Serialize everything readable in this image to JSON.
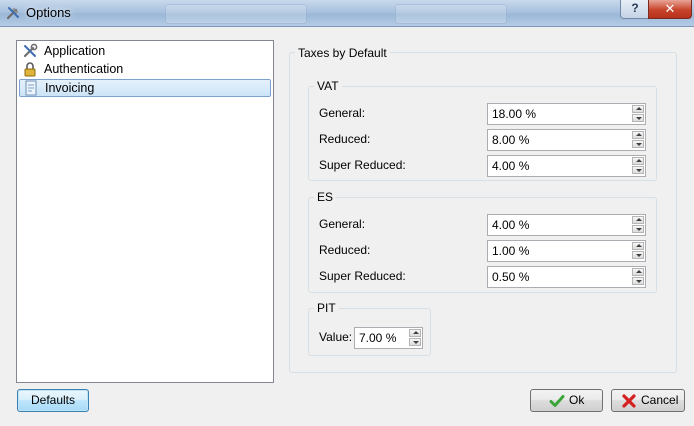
{
  "window": {
    "title": "Options",
    "help_label": "?",
    "close_label": "✕"
  },
  "nav": {
    "items": [
      {
        "label": "Application",
        "icon": "tools-icon",
        "selected": false
      },
      {
        "label": "Authentication",
        "icon": "lock-icon",
        "selected": false
      },
      {
        "label": "Invoicing",
        "icon": "document-icon",
        "selected": true
      }
    ]
  },
  "taxes": {
    "title": "Taxes by Default",
    "vat": {
      "title": "VAT",
      "general_label": "General:",
      "general_value": "18.00 %",
      "reduced_label": "Reduced:",
      "reduced_value": "8.00 %",
      "super_label": "Super Reduced:",
      "super_value": "4.00 %"
    },
    "es": {
      "title": "ES",
      "general_label": "General:",
      "general_value": "4.00 %",
      "reduced_label": "Reduced:",
      "reduced_value": "1.00 %",
      "super_label": "Super Reduced:",
      "super_value": "0.50 %"
    },
    "pit": {
      "title": "PIT",
      "value_label": "Value:",
      "value": "7.00 %"
    }
  },
  "buttons": {
    "defaults": "Defaults",
    "ok": "Ok",
    "cancel": "Cancel"
  },
  "colors": {
    "ok_check": "#3aa63a",
    "cancel_x": "#d42020",
    "selection": "#cce4f7"
  }
}
